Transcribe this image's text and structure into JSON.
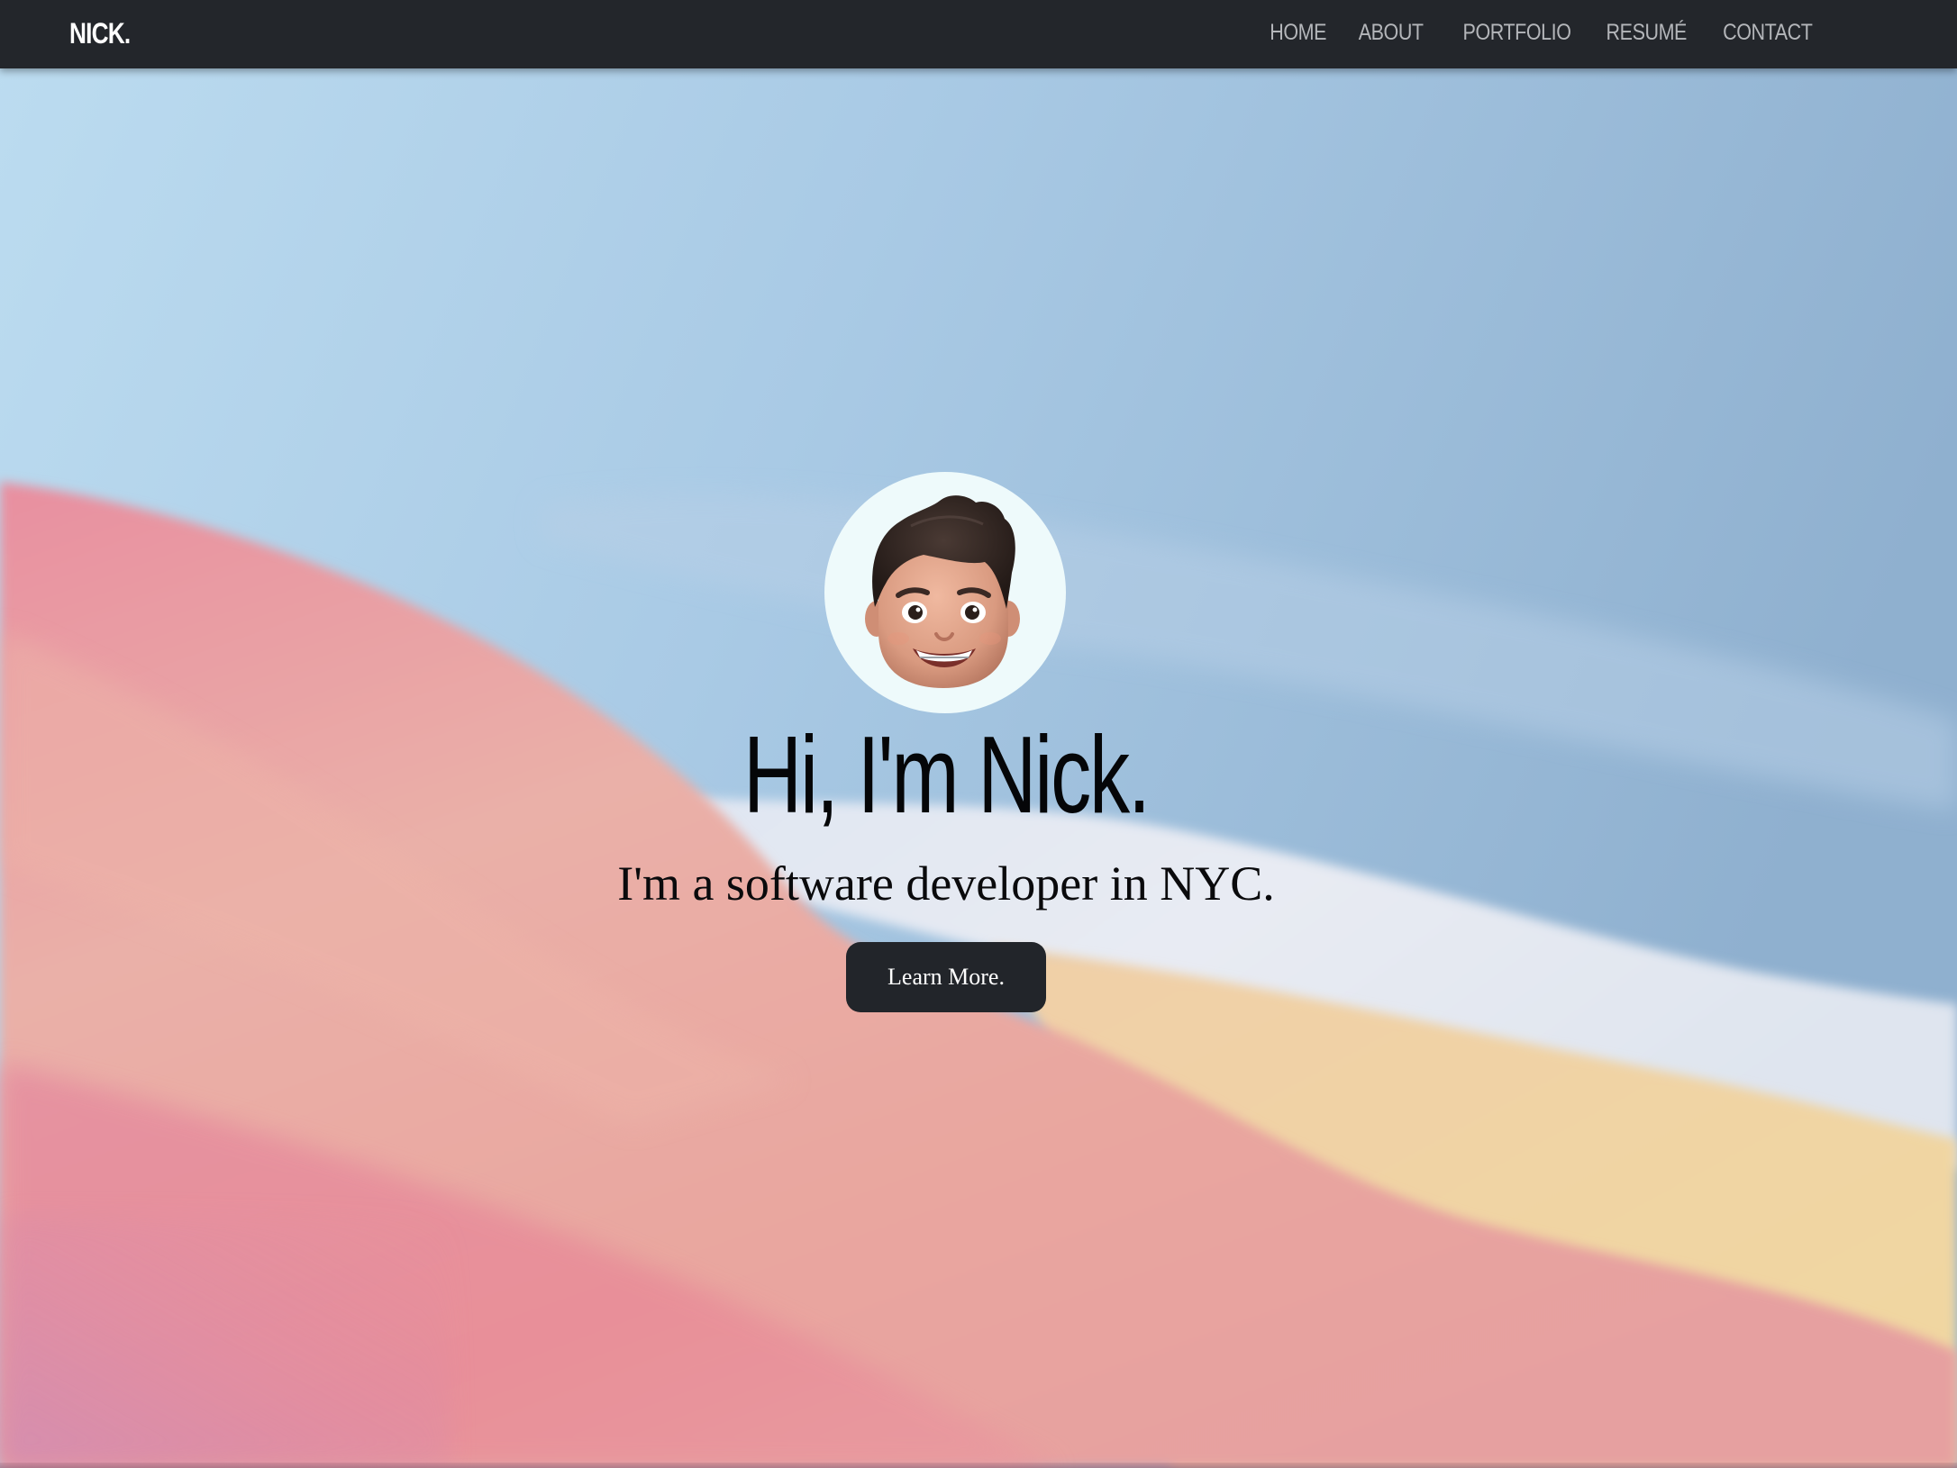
{
  "navbar": {
    "brand": "NICK.",
    "links": [
      {
        "label": "HOME"
      },
      {
        "label": "ABOUT"
      },
      {
        "label": "PORTFOLIO"
      },
      {
        "label": "RESUMÉ"
      },
      {
        "label": "CONTACT"
      }
    ]
  },
  "hero": {
    "avatar_icon": "memoji-avatar",
    "title": "Hi, I'm Nick.",
    "subtitle": "I'm a software developer in NYC.",
    "button_label": "Learn More."
  },
  "colors": {
    "navbar_bg": "#23262b",
    "nav_link": "#b4b6ba",
    "sky_blue": "#a9c8e4",
    "pink": "#e9a0a6",
    "peach": "#efc99c",
    "button_bg": "#22252a"
  }
}
